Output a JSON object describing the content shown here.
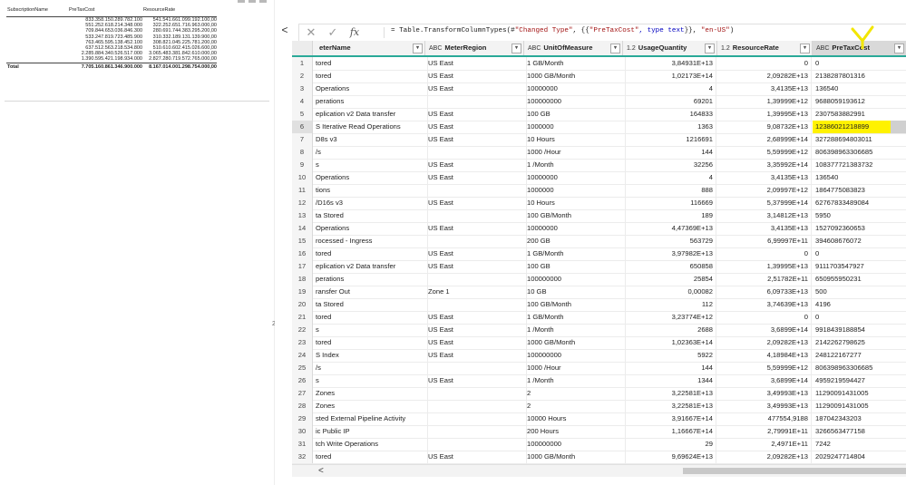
{
  "pbi_table": {
    "headers": [
      "SubscriptionName",
      "PreTaxCost",
      "ResourceRate"
    ],
    "rows": [
      [
        "",
        "833.358.150.289.782.100",
        "541.541.661.099.192.100,00"
      ],
      [
        "",
        "551.252.618.214.348.000",
        "322.252.651.716.963.000,00"
      ],
      [
        "",
        "709.844.653.036.846.300",
        "280.691.744.383.295.200,00"
      ],
      [
        "",
        "533.247.819.723.485.900",
        "310.332.189.131.139.900,00"
      ],
      [
        "",
        "763.465.595.138.452.100",
        "308.821.045.225.781.200,00"
      ],
      [
        "",
        "637.512.563.218.534.800",
        "510.610.602.415.026.600,00"
      ],
      [
        "",
        "2.285.884.340.526.517.000",
        "3.065.483.381.842.610.000,00"
      ],
      [
        "",
        "1.390.595.421.198.934.000",
        "2.827.280.719.572.765.000,00"
      ]
    ],
    "total_label": "Total",
    "total_pretax": "7.705.160.861.346.900.000",
    "total_rate": "8.167.014.001.298.754.000,00"
  },
  "side_text": "2...",
  "formula_bar": {
    "cancel_icon": "close-icon",
    "apply_icon": "check-icon",
    "fx_label": "fx",
    "collapse_label": "<",
    "formula_prefix": "= Table.TransformColumnTypes(#",
    "formula_step": "\"Changed Type\"",
    "formula_mid": ", {{",
    "formula_col": "\"PreTaxCost\"",
    "formula_type_kw": ", type text",
    "formula_end": "}}, ",
    "formula_culture": "\"en-US\"",
    "formula_close": ")"
  },
  "grid": {
    "columns": [
      {
        "type_icon": "",
        "name": "eterName"
      },
      {
        "type_icon": "ABC",
        "name": "MeterRegion"
      },
      {
        "type_icon": "ABC",
        "name": "UnitOfMeasure"
      },
      {
        "type_icon": "1.2",
        "name": "UsageQuantity"
      },
      {
        "type_icon": "1.2",
        "name": "ResourceRate"
      },
      {
        "type_icon": "ABC",
        "name": "PreTaxCost"
      }
    ],
    "rows": [
      [
        "1",
        "tored",
        "US East",
        "1 GB/Month",
        "3,84931E+13",
        "0",
        "0"
      ],
      [
        "2",
        "tored",
        "US East",
        "1000 GB/Month",
        "1,02173E+14",
        "2,09282E+13",
        "2138287801316"
      ],
      [
        "3",
        "Operations",
        "US East",
        "10000000",
        "4",
        "3,4135E+13",
        "136540"
      ],
      [
        "4",
        "perations",
        "",
        "100000000",
        "69201",
        "1,39999E+12",
        "9688059193612"
      ],
      [
        "5",
        "eplication v2 Data transfer",
        "US East",
        "100 GB",
        "164833",
        "1,39995E+13",
        "2307583882991"
      ],
      [
        "6",
        "S Iterative Read Operations",
        "US East",
        "1000000",
        "1363",
        "9,08732E+13",
        "12386021218899"
      ],
      [
        "7",
        "D8s v3",
        "US East",
        "10 Hours",
        "1216691",
        "2,68999E+14",
        "327288694803011"
      ],
      [
        "8",
        "/s",
        "",
        "1000 /Hour",
        "144",
        "5,59999E+12",
        "806398963306685"
      ],
      [
        "9",
        "s",
        "US East",
        "1 /Month",
        "32256",
        "3,35992E+14",
        "108377721383732"
      ],
      [
        "10",
        "Operations",
        "US East",
        "10000000",
        "4",
        "3,4135E+13",
        "136540"
      ],
      [
        "11",
        "tions",
        "",
        "1000000",
        "888",
        "2,09997E+12",
        "1864775083823"
      ],
      [
        "12",
        "/D16s v3",
        "US East",
        "10 Hours",
        "116669",
        "5,37999E+14",
        "62767833489084"
      ],
      [
        "13",
        "ta Stored",
        "",
        "100 GB/Month",
        "189",
        "3,14812E+13",
        "5950"
      ],
      [
        "14",
        "Operations",
        "US East",
        "10000000",
        "4,47369E+13",
        "3,4135E+13",
        "1527092360653"
      ],
      [
        "15",
        "rocessed - Ingress",
        "",
        "200 GB",
        "563729",
        "6,99997E+11",
        "394608676072"
      ],
      [
        "16",
        "tored",
        "US East",
        "1 GB/Month",
        "3,97982E+13",
        "0",
        "0"
      ],
      [
        "17",
        "eplication v2 Data transfer",
        "US East",
        "100 GB",
        "650858",
        "1,39995E+13",
        "9111703547927"
      ],
      [
        "18",
        "perations",
        "",
        "100000000",
        "25854",
        "2,51782E+11",
        "650955950231"
      ],
      [
        "19",
        "ransfer Out",
        "Zone 1",
        "10 GB",
        "0,00082",
        "6,09733E+13",
        "500"
      ],
      [
        "20",
        "ta Stored",
        "",
        "100 GB/Month",
        "112",
        "3,74639E+13",
        "4196"
      ],
      [
        "21",
        "tored",
        "US East",
        "1 GB/Month",
        "3,23774E+12",
        "0",
        "0"
      ],
      [
        "22",
        "s",
        "US East",
        "1 /Month",
        "2688",
        "3,6899E+14",
        "9918439188854"
      ],
      [
        "23",
        "tored",
        "US East",
        "1000 GB/Month",
        "1,02363E+14",
        "2,09282E+13",
        "2142262798625"
      ],
      [
        "24",
        "S Index",
        "US East",
        "100000000",
        "5922",
        "4,18984E+13",
        "248122167277"
      ],
      [
        "25",
        "/s",
        "",
        "1000 /Hour",
        "144",
        "5,59999E+12",
        "806398963306685"
      ],
      [
        "26",
        "s",
        "US East",
        "1 /Month",
        "1344",
        "3,6899E+14",
        "4959219594427"
      ],
      [
        "27",
        " Zones",
        "",
        "2",
        "3,22581E+13",
        "3,49993E+13",
        "11290091431005"
      ],
      [
        "28",
        " Zones",
        "",
        "2",
        "3,22581E+13",
        "3,49993E+13",
        "11290091431005"
      ],
      [
        "29",
        "sted External Pipeline Activity",
        "",
        "10000 Hours",
        "3,91667E+14",
        "477554,9188",
        "187042343203"
      ],
      [
        "30",
        "ic Public IP",
        "",
        "200 Hours",
        "1,16667E+14",
        "2,79991E+11",
        "3266563477158"
      ],
      [
        "31",
        "tch Write Operations",
        "",
        "100000000",
        "29",
        "2,4971E+11",
        "7242"
      ],
      [
        "32",
        "tored",
        "US East",
        "1000 GB/Month",
        "9,69624E+13",
        "2,09282E+13",
        "2029247714804"
      ]
    ],
    "selected_row": 6
  },
  "scroll": {
    "left_arrow": "<"
  },
  "colors": {
    "accent": "#2aa998",
    "highlight": "#fff200",
    "annotation": "#f2e600"
  }
}
